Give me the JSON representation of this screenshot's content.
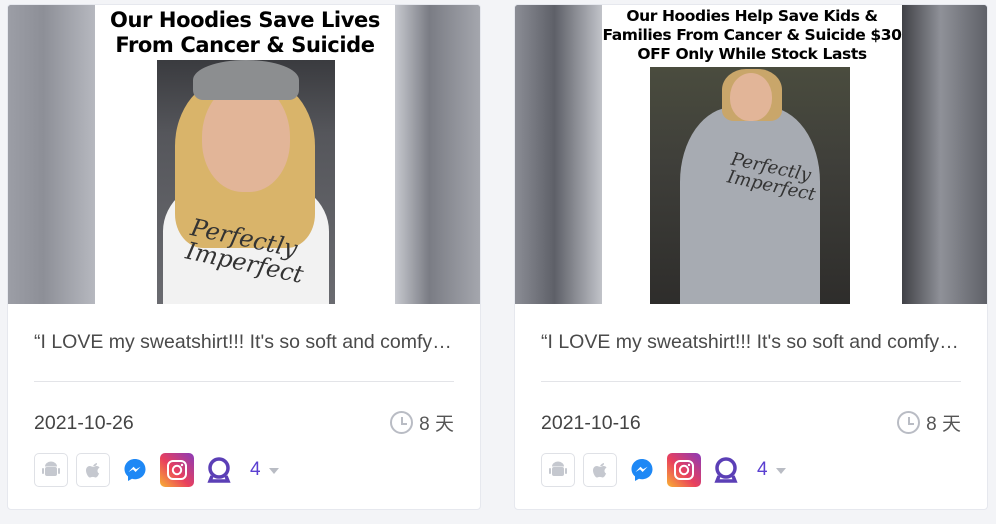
{
  "cards": [
    {
      "ad_headline": "Our Hoodies Save Lives From Cancer & Suicide",
      "hoodie_text": "Perfectly Imperfect",
      "caption": "“I LOVE my sweatshirt!!! It's so soft and comfy and the message is perfect",
      "date": "2021-10-26",
      "duration": "8 天",
      "platform_icons": [
        "android-icon",
        "apple-icon",
        "messenger-icon",
        "instagram-icon",
        "audience-network-icon"
      ],
      "more_count": "4"
    },
    {
      "ad_headline": "Our Hoodies Help Save Kids & Families From Cancer & Suicide $30 OFF Only While Stock Lasts",
      "hoodie_text": "Perfectly Imperfect",
      "caption": "“I LOVE my sweatshirt!!! It's so soft and comfy and the message is perfect",
      "date": "2021-10-16",
      "duration": "8 天",
      "platform_icons": [
        "android-icon",
        "apple-icon",
        "messenger-icon",
        "instagram-icon",
        "audience-network-icon"
      ],
      "more_count": "4"
    }
  ],
  "colors": {
    "accent": "#5a3fd1",
    "messenger": "#1e88f5",
    "audience_network": "#5b3fb6",
    "muted_icon": "#c5c8cf"
  }
}
